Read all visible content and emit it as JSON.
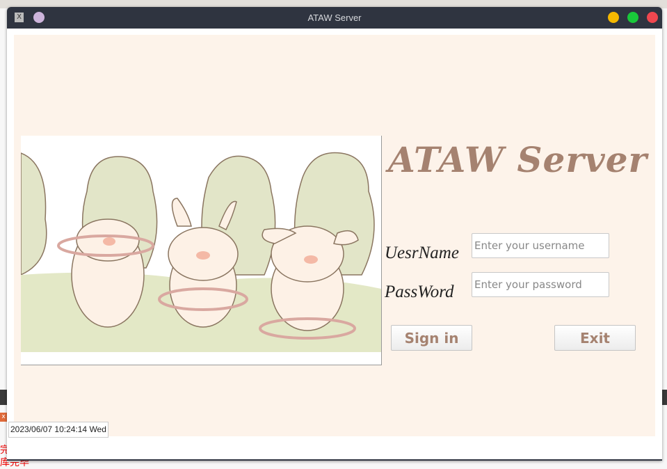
{
  "window": {
    "title": "ATAW Server",
    "app_icon": "x-window-icon"
  },
  "controls": {
    "minimize_color": "#f5b800",
    "maximize_color": "#19c83a",
    "close_color": "#f0474f"
  },
  "login": {
    "brand": "ATAW Server",
    "username_label": "UesrName",
    "username_placeholder": "Enter your username",
    "password_label": "PassWord",
    "password_placeholder": "Enter your password",
    "signin_label": "Sign in",
    "exit_label": "Exit"
  },
  "status_bar": {
    "datetime": "2023/06/07 10:24:14 Wed"
  },
  "background": {
    "red_text": "完\n库完毕"
  },
  "colors": {
    "accent": "#a58270",
    "panel": "#fdf3ea"
  }
}
